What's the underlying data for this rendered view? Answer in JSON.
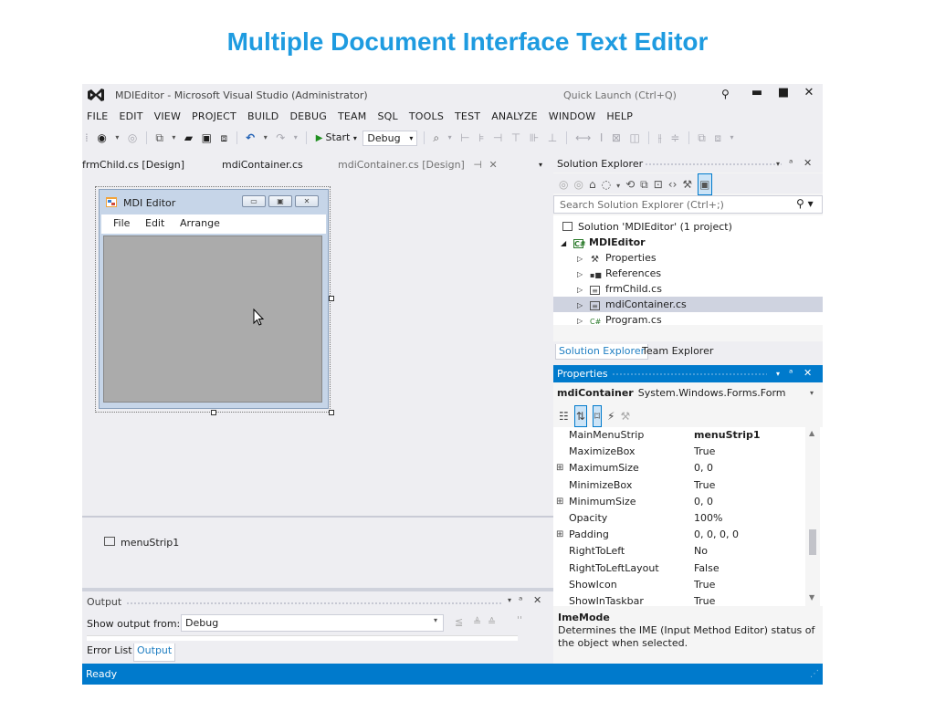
{
  "slide_title": "Multiple Document Interface Text Editor",
  "window": {
    "title": "MDIEditor - Microsoft Visual Studio (Administrator)",
    "quick_launch_placeholder": "Quick Launch (Ctrl+Q)",
    "minimize": "▬",
    "maximize": "■",
    "close": "✕"
  },
  "menu": [
    "FILE",
    "EDIT",
    "VIEW",
    "PROJECT",
    "BUILD",
    "DEBUG",
    "TEAM",
    "SQL",
    "TOOLS",
    "TEST",
    "ANALYZE",
    "WINDOW",
    "HELP"
  ],
  "toolbar": {
    "start_label": "Start",
    "configuration": "Debug"
  },
  "tabs": {
    "frmchild_design": "frmChild.cs [Design]",
    "mdicontainer_cs": "mdiContainer.cs",
    "mdicontainer_design": "mdiContainer.cs [Design]",
    "pin": "⊣",
    "close": "✕"
  },
  "designer": {
    "form_title": "MDI Editor",
    "form_menu": [
      "File",
      "Edit",
      "Arrange"
    ],
    "tray_component": "menuStrip1"
  },
  "output": {
    "title": "Output",
    "show_from_label": "Show output from:",
    "source": "Debug",
    "tabs": [
      "Error List",
      "Output"
    ]
  },
  "solution_explorer": {
    "title": "Solution Explorer",
    "search_placeholder": "Search Solution Explorer (Ctrl+;)",
    "tree": [
      {
        "label": "Solution 'MDIEditor' (1 project)"
      },
      {
        "label": "MDIEditor"
      },
      {
        "label": "Properties"
      },
      {
        "label": "References"
      },
      {
        "label": "frmChild.cs"
      },
      {
        "label": "mdiContainer.cs",
        "selected": true
      },
      {
        "label": "Program.cs"
      }
    ],
    "tabs": [
      "Solution Explorer",
      "Team Explorer"
    ]
  },
  "properties": {
    "title": "Properties",
    "object_name": "mdiContainer",
    "object_type": "System.Windows.Forms.Form",
    "rows": [
      {
        "name": "MainMenuStrip",
        "value": "menuStrip1",
        "bold": true
      },
      {
        "name": "MaximizeBox",
        "value": "True"
      },
      {
        "name": "MaximumSize",
        "value": "0, 0",
        "expandable": true
      },
      {
        "name": "MinimizeBox",
        "value": "True"
      },
      {
        "name": "MinimumSize",
        "value": "0, 0",
        "expandable": true
      },
      {
        "name": "Opacity",
        "value": "100%"
      },
      {
        "name": "Padding",
        "value": "0, 0, 0, 0",
        "expandable": true
      },
      {
        "name": "RightToLeft",
        "value": "No"
      },
      {
        "name": "RightToLeftLayout",
        "value": "False"
      },
      {
        "name": "ShowIcon",
        "value": "True"
      },
      {
        "name": "ShowInTaskbar",
        "value": "True"
      }
    ],
    "desc_title": "ImeMode",
    "desc_text": "Determines the IME (Input Method Editor) status of the object when selected."
  },
  "status": "Ready",
  "colors": {
    "accent": "#007acc",
    "slide_title": "#1e9be0"
  }
}
